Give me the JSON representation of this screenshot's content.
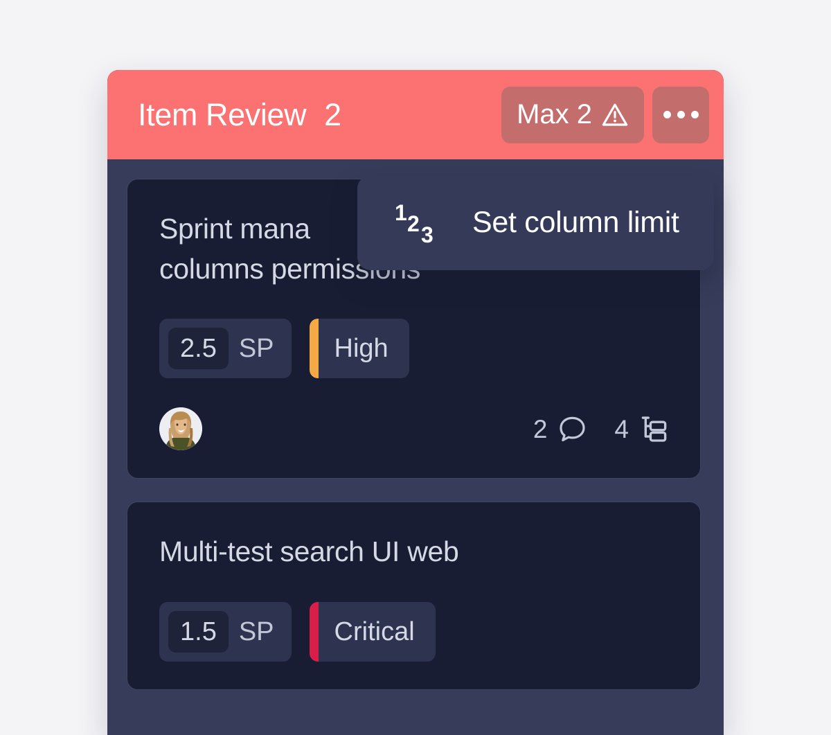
{
  "page": {
    "background_color": "#f4f4f7"
  },
  "column": {
    "title": "Item Review",
    "count": "2",
    "header_color": "#fc7272",
    "body_color": "#373c5a",
    "wip_limit": {
      "label": "Max 2",
      "icon": "warning-triangle-icon",
      "badge_color": "#c36d6d"
    },
    "menu": {
      "icon": "ellipsis-icon",
      "label": "Column options"
    }
  },
  "tooltip": {
    "icon": "numbered-list-123-icon",
    "label": "Set column limit",
    "background_color": "#343a57"
  },
  "cards": [
    {
      "title": "Sprint mana… columns permissions",
      "title_line_1": "Sprint mana",
      "title_line_2": "columns permissions",
      "story_points": "2.5",
      "story_points_unit": "SP",
      "priority": "High",
      "priority_color": "#f5a944",
      "assignee": "avatar",
      "comments_count": "2",
      "comments_icon": "comment-bubble-icon",
      "subtasks_count": "4",
      "subtasks_icon": "subtask-tree-icon"
    },
    {
      "title": "Multi-test search UI web",
      "title_line_1": "Multi-test search UI web",
      "title_line_2": "",
      "story_points": "1.5",
      "story_points_unit": "SP",
      "priority": "Critical",
      "priority_color": "#d91f49"
    }
  ]
}
